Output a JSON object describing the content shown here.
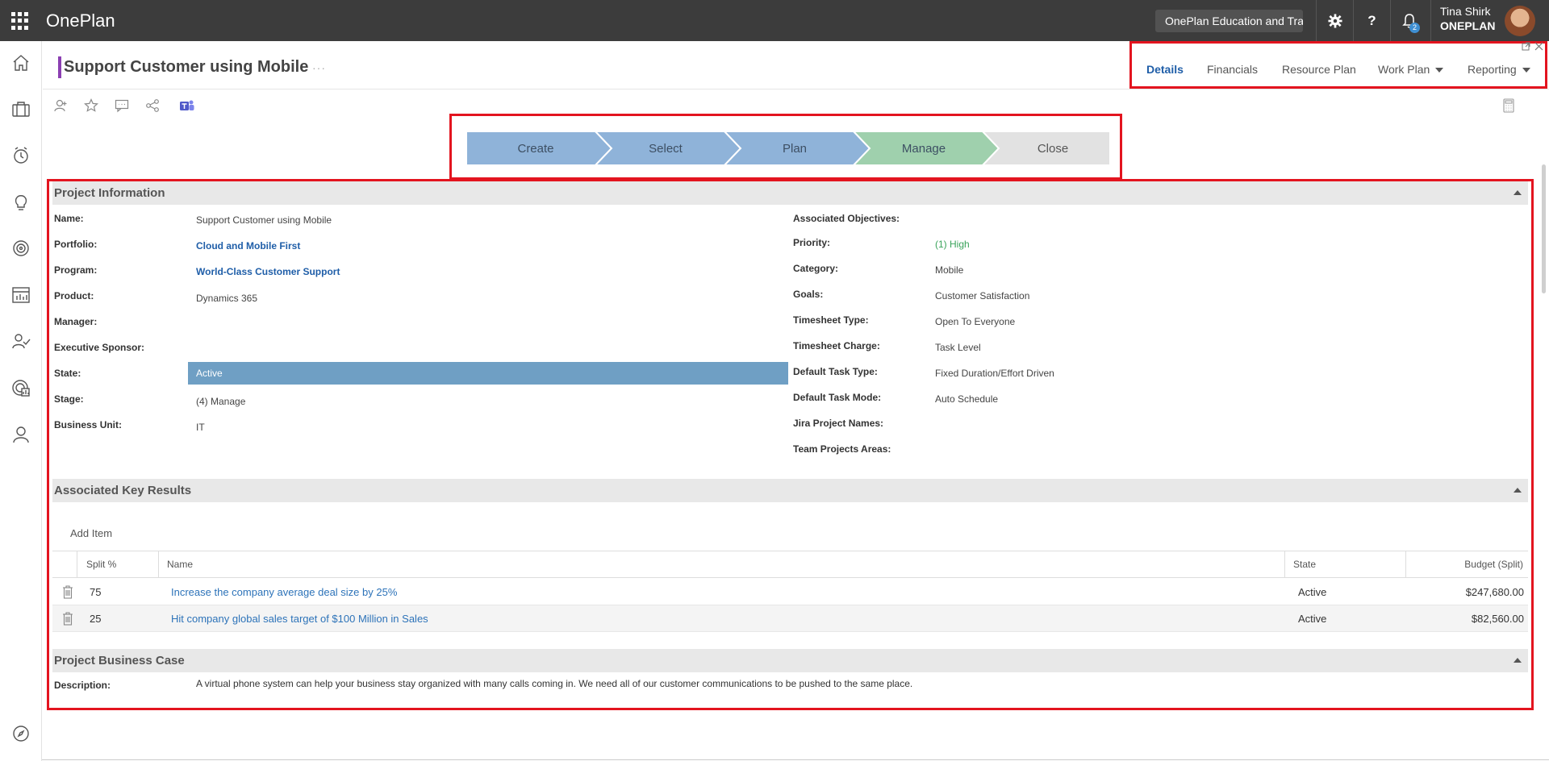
{
  "app": {
    "brand": "OnePlan",
    "org_selector": "OnePlan Education and Trai",
    "notification_count": "2",
    "user_name": "Tina Shirk",
    "user_org": "ONEPLAN"
  },
  "nav_icons": [
    "home-icon",
    "portfolio-icon",
    "timesheet-icon",
    "ideas-icon",
    "objectives-icon",
    "reports-icon",
    "resources-icon",
    "analytics-icon",
    "profile-icon",
    "compass-icon"
  ],
  "header": {
    "title": "Support Customer using Mobile",
    "title_more": "···"
  },
  "tabs": [
    {
      "label": "Details",
      "active": true
    },
    {
      "label": "Financials"
    },
    {
      "label": "Resource Plan"
    },
    {
      "label": "Work Plan",
      "dropdown": true
    },
    {
      "label": "Reporting",
      "dropdown": true
    }
  ],
  "stages": [
    "Create",
    "Select",
    "Plan",
    "Manage",
    "Close"
  ],
  "colors": {
    "stage_done": "#8fb3d9",
    "stage_current": "#9fd0ad",
    "stage_future": "#e2e2e2",
    "link": "#1f5ea8",
    "highlight_frame": "#e3141f"
  },
  "sections": {
    "project_information": "Project Information",
    "associated_key_results": "Associated Key Results",
    "project_business_case": "Project Business Case"
  },
  "fields_left": [
    {
      "label": "Name:",
      "value": "Support Customer using Mobile"
    },
    {
      "label": "Portfolio:",
      "value": "Cloud and Mobile First"
    },
    {
      "label": "Program:",
      "value": "World-Class Customer Support"
    },
    {
      "label": "Product:",
      "value": "Dynamics 365"
    },
    {
      "label": "Manager:",
      "value": ""
    },
    {
      "label": "Executive Sponsor:",
      "value": ""
    },
    {
      "label": "State:",
      "value": "Active"
    },
    {
      "label": "Stage:",
      "value": "(4) Manage"
    },
    {
      "label": "Business Unit:",
      "value": "IT"
    }
  ],
  "fields_right": [
    {
      "label": "Associated Objectives:",
      "value": ""
    },
    {
      "label": "Priority:",
      "value": "(1) High"
    },
    {
      "label": "Category:",
      "value": "Mobile"
    },
    {
      "label": "Goals:",
      "value": "Customer Satisfaction"
    },
    {
      "label": "Timesheet Type:",
      "value": "Open To Everyone"
    },
    {
      "label": "Timesheet Charge:",
      "value": "Task Level"
    },
    {
      "label": "Default Task Type:",
      "value": "Fixed Duration/Effort Driven"
    },
    {
      "label": "Default Task Mode:",
      "value": "Auto Schedule"
    },
    {
      "label": "Jira Project Names:",
      "value": ""
    },
    {
      "label": "Team Projects Areas:",
      "value": ""
    }
  ],
  "key_results": {
    "add_item": "Add Item",
    "columns": [
      "Split %",
      "Name",
      "State",
      "Budget (Split)"
    ],
    "rows": [
      {
        "split": "75",
        "name": "Increase the company average deal size by 25%",
        "state": "Active",
        "budget": "$247,680.00"
      },
      {
        "split": "25",
        "name": "Hit company global sales target of $100 Million in Sales",
        "state": "Active",
        "budget": "$82,560.00"
      }
    ]
  },
  "business_case": {
    "label": "Description:",
    "text": "A virtual phone system can help your business stay organized with many calls coming in.  We need all of our customer communications to be pushed to the same place."
  }
}
